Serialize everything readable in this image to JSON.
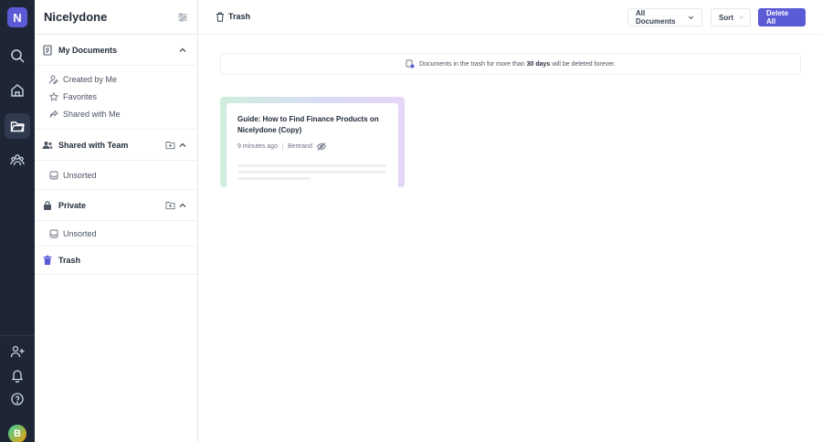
{
  "app": {
    "logo_letter": "N",
    "name": "Nicelydone",
    "avatar_letter": "B"
  },
  "sidebar": {
    "my_documents": {
      "title": "My Documents",
      "items": [
        {
          "label": "Created by Me",
          "icon": "user-edit-icon"
        },
        {
          "label": "Favorites",
          "icon": "star-icon"
        },
        {
          "label": "Shared with Me",
          "icon": "share-icon"
        }
      ]
    },
    "shared_team": {
      "title": "Shared with Team",
      "items": [
        {
          "label": "Unsorted",
          "icon": "inbox-icon"
        }
      ]
    },
    "private": {
      "title": "Private",
      "items": [
        {
          "label": "Unsorted",
          "icon": "inbox-icon"
        }
      ]
    },
    "trash": {
      "title": "Trash"
    }
  },
  "topbar": {
    "title": "Trash",
    "filter_label": "All Documents",
    "sort_label": "Sort",
    "delete_label": "Delete All"
  },
  "notice": {
    "before": "Documents in the trash for more than",
    "bold": "30 days",
    "after": "will be deleted forever."
  },
  "documents": [
    {
      "title": "Guide: How to Find Finance Products on Nicelydone (Copy)",
      "time": "9 minutes ago",
      "author": "Bertrand"
    }
  ],
  "colors": {
    "accent": "#5b5bd6",
    "rail": "#1e2635"
  }
}
